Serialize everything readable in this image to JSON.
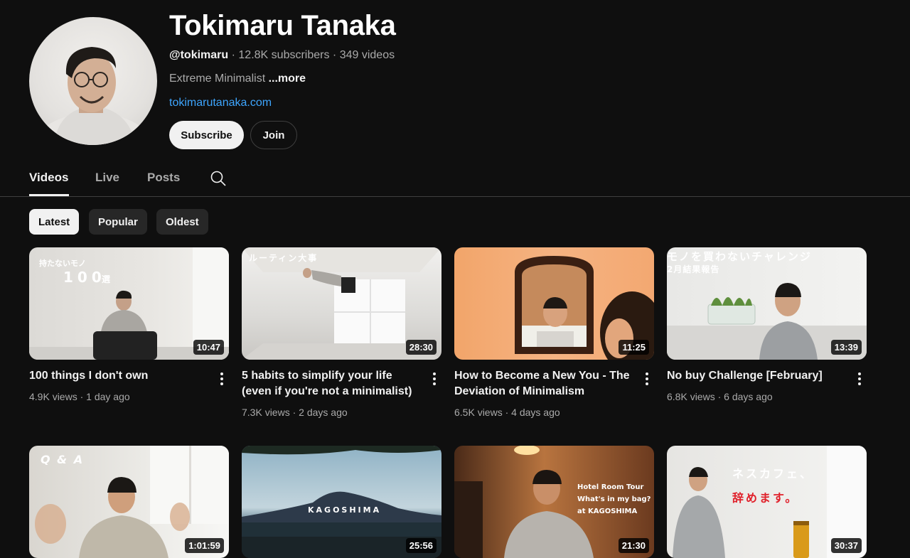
{
  "channel": {
    "name": "Tokimaru Tanaka",
    "handle": "@tokimaru",
    "subscribers": "12.8K subscribers",
    "video_count": "349 videos",
    "description": "Extreme Minimalist",
    "more_label": "...more",
    "link": "tokimarutanaka.com",
    "subscribe_label": "Subscribe",
    "join_label": "Join"
  },
  "tabs": [
    {
      "label": "Videos",
      "active": true
    },
    {
      "label": "Live",
      "active": false
    },
    {
      "label": "Posts",
      "active": false
    }
  ],
  "search_icon": "search-icon",
  "chips": [
    {
      "label": "Latest",
      "active": true
    },
    {
      "label": "Popular",
      "active": false
    },
    {
      "label": "Oldest",
      "active": false
    }
  ],
  "videos": [
    {
      "title": "100 things I don't own",
      "views": "4.9K views",
      "age": "1 day ago",
      "duration": "10:47",
      "thumb_text": [
        "持たないモノ",
        "100",
        "選"
      ]
    },
    {
      "title": "5 habits to simplify your life (even if you're not a minimalist)",
      "views": "7.3K views",
      "age": "2 days ago",
      "duration": "28:30",
      "thumb_text": [
        "ルーティン大事"
      ]
    },
    {
      "title": "How to Become a New You - The Deviation of Minimalism",
      "views": "6.5K views",
      "age": "4 days ago",
      "duration": "11:25",
      "thumb_text": []
    },
    {
      "title": "No buy Challenge [February]",
      "views": "6.8K views",
      "age": "6 days ago",
      "duration": "13:39",
      "thumb_text": [
        "モノを買わないチャレンジ",
        "2月結果報告"
      ]
    },
    {
      "title": "",
      "views": "",
      "age": "",
      "duration": "1:01:59",
      "thumb_text": [
        "Q & A"
      ]
    },
    {
      "title": "",
      "views": "",
      "age": "",
      "duration": "25:56",
      "thumb_text": [
        "KAGOSHIMA"
      ]
    },
    {
      "title": "",
      "views": "",
      "age": "",
      "duration": "21:30",
      "thumb_text": [
        "Hotel Room Tour",
        "What's in my bag?",
        "at KAGOSHIMA"
      ]
    },
    {
      "title": "",
      "views": "",
      "age": "",
      "duration": "30:37",
      "thumb_text": [
        "ネスカフェ、",
        "辞めます。"
      ]
    }
  ],
  "meta_separator": "·"
}
